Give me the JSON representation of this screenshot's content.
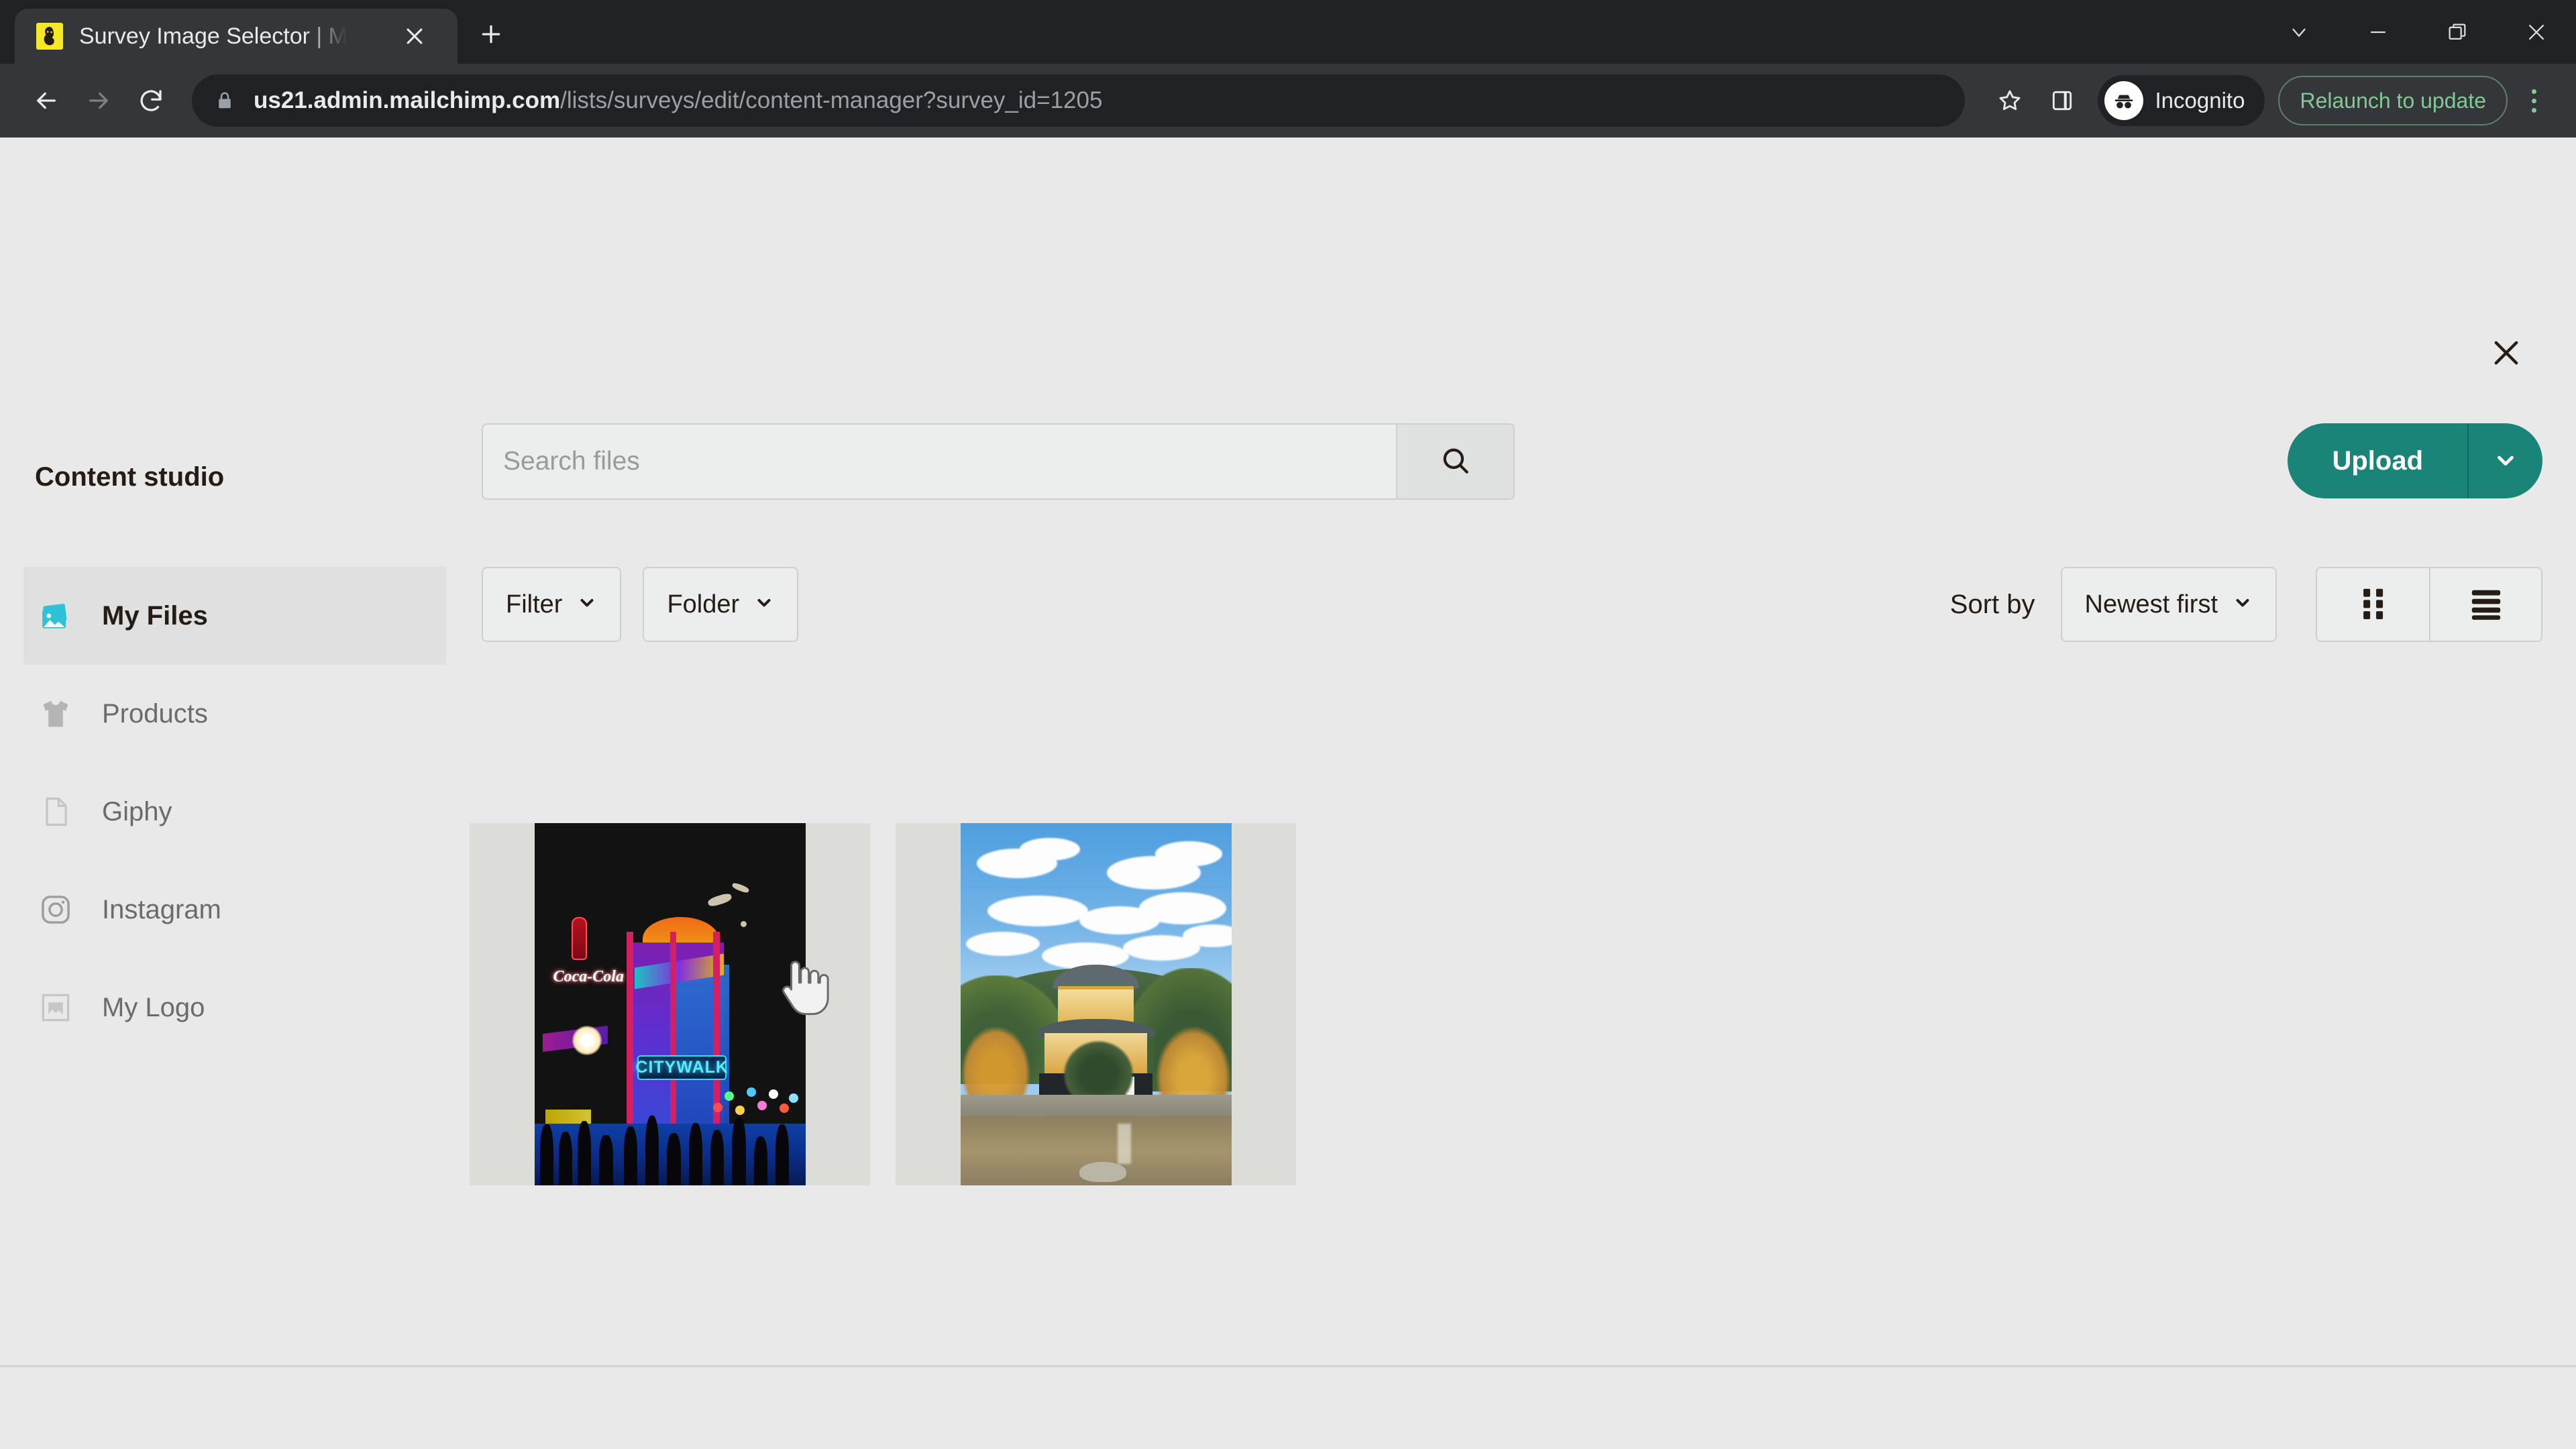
{
  "browser": {
    "tab": {
      "title": "Survey Image Selector | Mailchimp",
      "favicon_name": "mailchimp-favicon",
      "close_label": "✕"
    },
    "newtab_label": "+",
    "window_controls": [
      {
        "name": "tab-search-chevron",
        "glyph": "⌄"
      },
      {
        "name": "minimize",
        "glyph": "−"
      },
      {
        "name": "restore",
        "glyph": "❐"
      },
      {
        "name": "close",
        "glyph": "✕"
      }
    ],
    "nav": {
      "back_label": "←",
      "forward_label": "→",
      "reload_label": "↻"
    },
    "omnibox": {
      "lock_icon": "lock-icon",
      "url_domain": "us21.admin.mailchimp.com",
      "url_path": "/lists/surveys/edit/content-manager?survey_id=1205",
      "url_full": "us21.admin.mailchimp.com/lists/surveys/edit/content-manager?survey_id=1205"
    },
    "bookmark_icon": "star-icon",
    "sidepanel_icon": "side-panel-icon",
    "incognito_label": "Incognito",
    "relaunch_label": "Relaunch to update",
    "menu_icon": "kebab-menu-icon",
    "accent_green": "#81c995",
    "chrome_bg": "#35363a"
  },
  "modal": {
    "close_label": "✕"
  },
  "header": {
    "title": "Content studio",
    "search": {
      "placeholder": "Search files",
      "value": "",
      "button_icon": "search-icon"
    },
    "upload": {
      "label": "Upload",
      "caret_icon": "chevron-down-icon",
      "color": "#1a8478"
    }
  },
  "sidebar": {
    "items": [
      {
        "label": "My Files",
        "icon": "photos-stack-icon",
        "active": true
      },
      {
        "label": "Products",
        "icon": "tshirt-icon",
        "active": false
      },
      {
        "label": "Giphy",
        "icon": "file-icon",
        "active": false
      },
      {
        "label": "Instagram",
        "icon": "instagram-icon",
        "active": false
      },
      {
        "label": "My Logo",
        "icon": "image-frame-icon",
        "active": false
      }
    ],
    "active_icon_color": "#2cc3d9"
  },
  "controls": {
    "filter": {
      "label": "Filter",
      "caret_icon": "chevron-down-icon"
    },
    "folder": {
      "label": "Folder",
      "caret_icon": "chevron-down-icon"
    },
    "sort_by_label": "Sort by",
    "sort_value": "Newest first",
    "sort_caret_icon": "chevron-down-icon",
    "view_grid_icon": "grid-view-icon",
    "view_list_icon": "list-view-icon",
    "view_active": "grid"
  },
  "gallery": {
    "items": [
      {
        "name": "citywalk-night-photo",
        "alt": "Neon CityWalk entrance at night with Coca-Cola sign",
        "sign_text": "CITYWALK",
        "brand_text": "Coca-Cola"
      },
      {
        "name": "golden-pavilion-photo",
        "alt": "Kinkaku-ji golden pavilion beside pond under blue sky"
      }
    ]
  },
  "cursor": {
    "type": "pointer-hand-cursor"
  }
}
